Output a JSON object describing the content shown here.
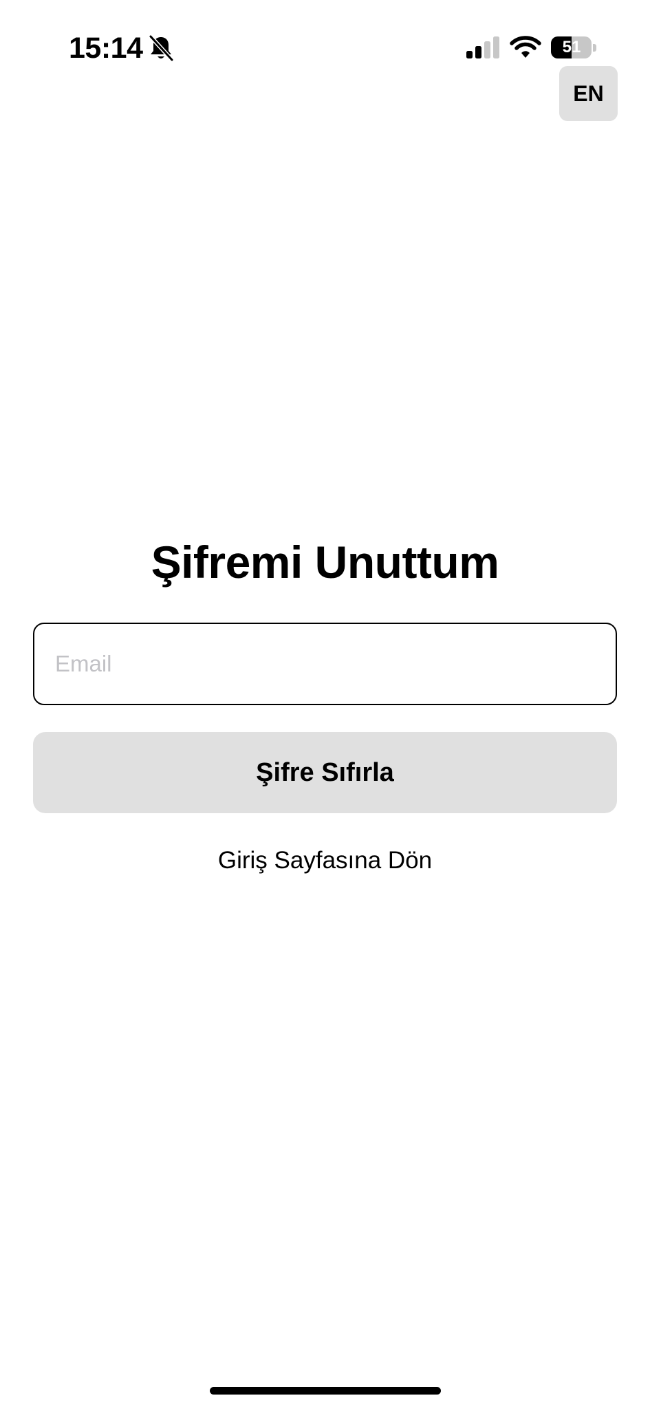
{
  "status_bar": {
    "time": "15:14",
    "bell_icon": "bell-slash-icon",
    "signal_icon": "cellular-signal-icon",
    "signal_bars_active": 2,
    "signal_bars_total": 4,
    "wifi_icon": "wifi-icon",
    "battery_level": "51",
    "battery_fraction": 0.51
  },
  "language_button": {
    "label": "EN"
  },
  "form": {
    "title": "Şifremi Unuttum",
    "email_placeholder": "Email",
    "email_value": "",
    "reset_button_label": "Şifre Sıfırla",
    "back_link_label": "Giriş Sayfasına Dön"
  },
  "colors": {
    "background": "#ffffff",
    "text": "#000000",
    "button_bg": "#e0e0e0",
    "placeholder": "#c2c2c6",
    "inactive_signal": "#c7c7c7"
  }
}
